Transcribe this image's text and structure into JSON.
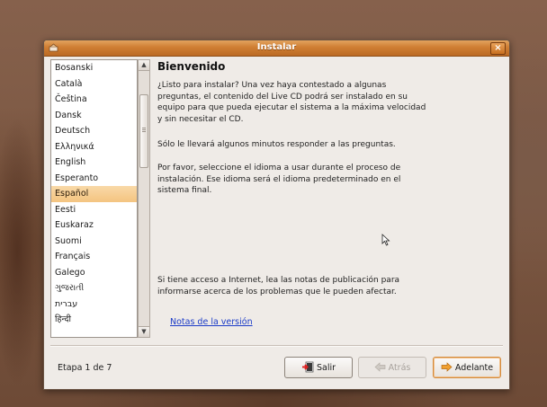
{
  "window": {
    "title": "Instalar",
    "close_label": "×"
  },
  "languages": {
    "items": [
      "Bosanski",
      "Català",
      "Čeština",
      "Dansk",
      "Deutsch",
      "Ελληνικά",
      "English",
      "Esperanto",
      "Español",
      "Eesti",
      "Euskaraz",
      "Suomi",
      "Français",
      "Galego",
      "ગુજરાતી",
      "עברית",
      "हिन्दी"
    ],
    "selected": "Español"
  },
  "content": {
    "heading": "Bienvenido",
    "paragraph_1": "¿Listo para instalar? Una vez haya contestado a algunas preguntas, el contenido del Live CD podrá ser instalado en su equipo para que pueda ejecutar el sistema a la máxima velocidad y sin necesitar el CD.",
    "paragraph_2": "Sólo le llevará algunos minutos responder a las preguntas.",
    "paragraph_3": "Por favor, seleccione el idioma a usar durante el proceso de instalación. Ese idioma será el idioma predeterminado en el sistema final.",
    "paragraph_4": "Si tiene acceso a Internet, lea las notas de publicación para informarse acerca de los problemas que le pueden afectar.",
    "release_notes_link": "Notas de la versión"
  },
  "footer": {
    "step_label": "Etapa 1 de 7",
    "quit_label": "Salir",
    "back_label": "Atrás",
    "forward_label": "Adelante"
  },
  "colors": {
    "titlebar": "#cf7e33",
    "selection": "#f4c480",
    "link": "#1c3cc8"
  },
  "icons": [
    "installer-icon",
    "close-icon",
    "quit-icon",
    "back-arrow-icon",
    "forward-arrow-icon",
    "mouse-pointer-icon"
  ]
}
